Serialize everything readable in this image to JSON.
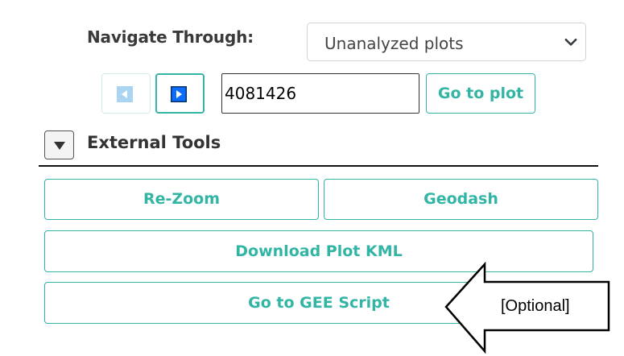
{
  "navigation": {
    "label": "Navigate Through:",
    "select": {
      "value": "Unanalyzed plots"
    },
    "plot_input_value": "4081426",
    "go_to_plot_label": "Go to plot"
  },
  "external_tools": {
    "title": "External Tools",
    "buttons": {
      "rezoom": "Re-Zoom",
      "geodash": "Geodash",
      "download_kml": "Download Plot KML",
      "gee_script": "Go to GEE Script"
    }
  },
  "annotation": {
    "text": "[Optional]"
  },
  "colors": {
    "accent": "#33b5a6",
    "nav_button_blue": "#0d6efd"
  },
  "icons": {
    "prev": "prev-arrow-icon",
    "next": "next-arrow-icon",
    "toggle": "caret-down-icon",
    "select": "chevron-down-icon"
  }
}
